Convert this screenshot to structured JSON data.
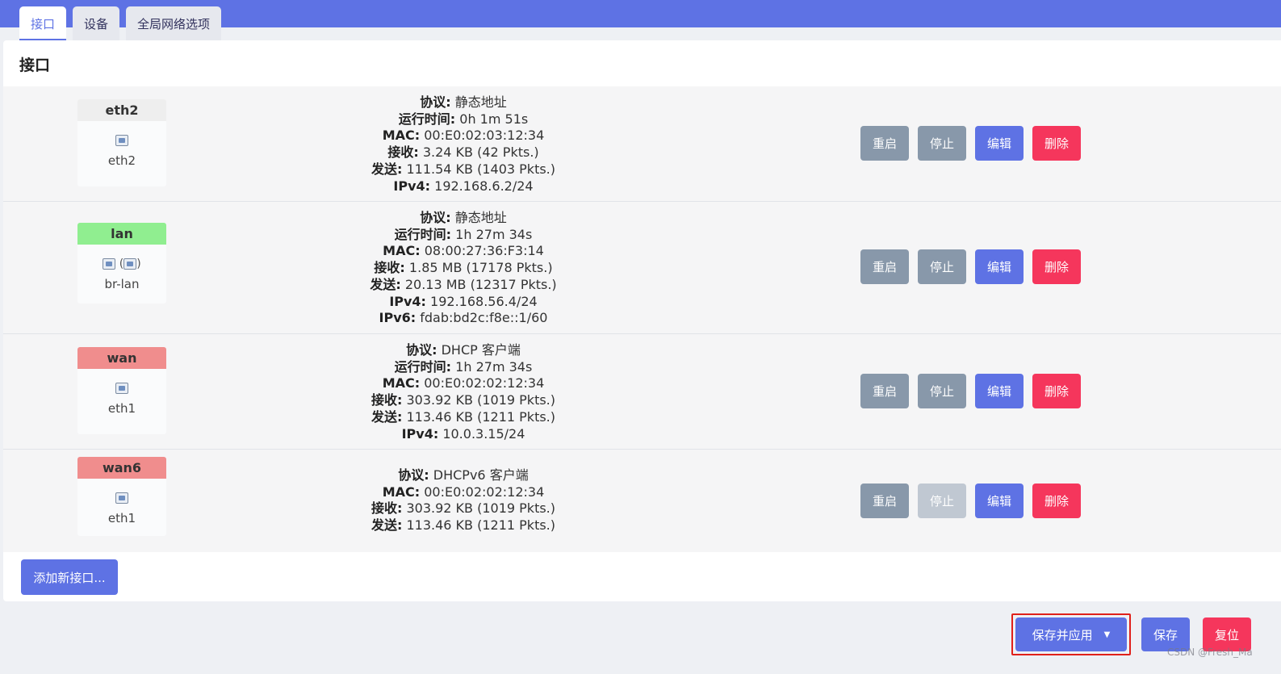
{
  "tabs": [
    {
      "label": "接口",
      "active": true
    },
    {
      "label": "设备",
      "active": false
    },
    {
      "label": "全局网络选项",
      "active": false
    }
  ],
  "panel_title": "接口",
  "labels": {
    "protocol": "协议:",
    "uptime": "运行时间:",
    "mac": "MAC:",
    "rx": "接收:",
    "tx": "发送:",
    "ipv4": "IPv4:",
    "ipv6": "IPv6:"
  },
  "actions": {
    "restart": "重启",
    "stop": "停止",
    "edit": "编辑",
    "delete": "删除"
  },
  "interfaces": [
    {
      "name": "eth2",
      "name_color": "#eeeeee",
      "device": "eth2",
      "protocol": "静态地址",
      "uptime": "0h 1m 51s",
      "mac": "00:E0:02:03:12:34",
      "rx": "3.24 KB (42 Pkts.)",
      "tx": "111.54 KB (1403 Pkts.)",
      "ipv4": "192.168.6.2/24",
      "stop_disabled": false
    },
    {
      "name": "lan",
      "name_color": "#90ee90",
      "device": "br-lan",
      "bridge_icons": "(",
      "bridge_close": ")",
      "protocol": "静态地址",
      "uptime": "1h 27m 34s",
      "mac": "08:00:27:36:F3:14",
      "rx": "1.85 MB (17178 Pkts.)",
      "tx": "20.13 MB (12317 Pkts.)",
      "ipv4": "192.168.56.4/24",
      "ipv6": "fdab:bd2c:f8e::1/60",
      "stop_disabled": false
    },
    {
      "name": "wan",
      "name_color": "#f08d8d",
      "device": "eth1",
      "protocol": "DHCP 客户端",
      "uptime": "1h 27m 34s",
      "mac": "00:E0:02:02:12:34",
      "rx": "303.92 KB (1019 Pkts.)",
      "tx": "113.46 KB (1211 Pkts.)",
      "ipv4": "10.0.3.15/24",
      "stop_disabled": false
    },
    {
      "name": "wan6",
      "name_color": "#f08d8d",
      "device": "eth1",
      "protocol": "DHCPv6 客户端",
      "mac": "00:E0:02:02:12:34",
      "rx": "303.92 KB (1019 Pkts.)",
      "tx": "113.46 KB (1211 Pkts.)",
      "stop_disabled": true
    }
  ],
  "add_interface": "添加新接口...",
  "footer": {
    "save_apply": "保存并应用",
    "caret": "▼",
    "save": "保存",
    "reset": "复位"
  },
  "watermark": "CSDN @Fresh_Ma",
  "colors": {
    "primary": "#5e72e4",
    "danger": "#f5365c",
    "secondary": "#8898aa"
  }
}
